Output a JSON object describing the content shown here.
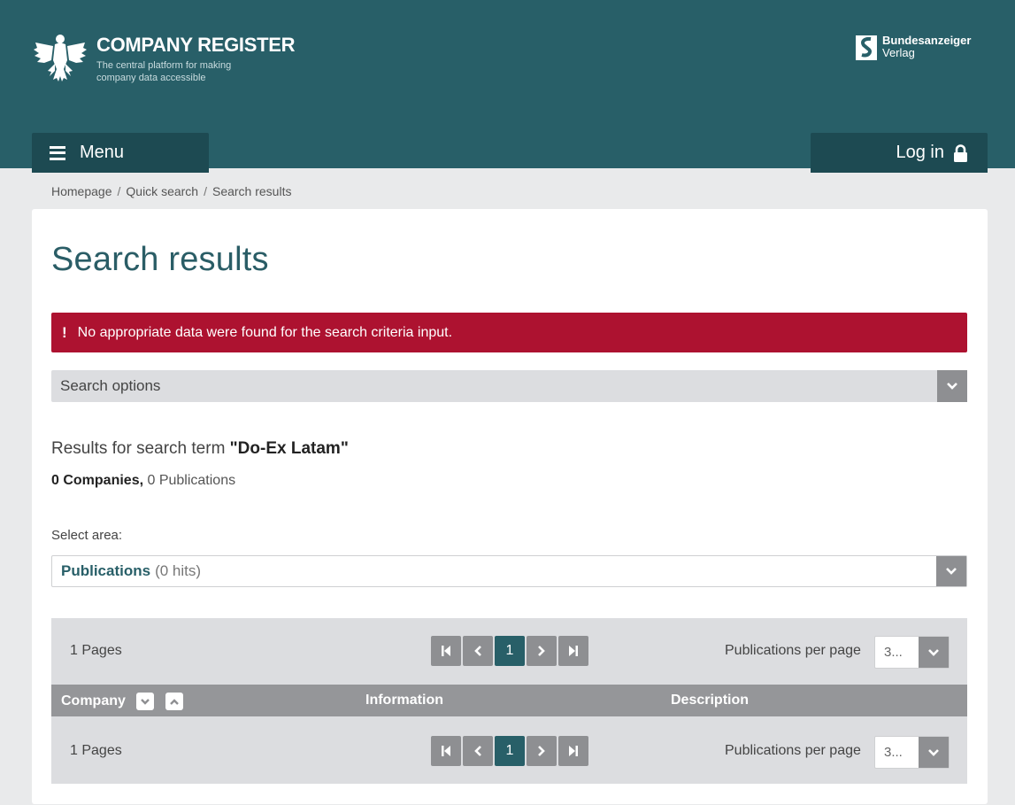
{
  "header": {
    "brand_title": "COMPANY REGISTER",
    "brand_subtitle": "The central platform for making company data accessible",
    "partner_line1": "Bundesanzeiger",
    "partner_line2": "Verlag",
    "menu_label": "Menu",
    "login_label": "Log in",
    "color_bg": "#285f68",
    "color_button": "#1d4a52"
  },
  "breadcrumb": {
    "items": [
      "Homepage",
      "Quick search",
      "Search results"
    ],
    "separator": "/"
  },
  "main": {
    "title": "Search results",
    "alert": {
      "icon": "exclamation-icon",
      "text": "No appropriate data were found for the search criteria input.",
      "color": "#ad1230"
    },
    "search_options_label": "Search options",
    "results_prefix": "Results for search term ",
    "search_term": "\"Do-Ex Latam\"",
    "counts": {
      "companies": "0 Companies,",
      "publications": "0 Publications"
    },
    "select_area_label": "Select area:",
    "area_select": {
      "selected": "Publications",
      "hits": "(0 hits)"
    },
    "pagination": {
      "pages_text": "1 Pages",
      "current_page": "1",
      "per_page_label": "Publications per page",
      "per_page_value": "3..."
    },
    "table": {
      "columns": [
        "Company",
        "Information",
        "Description"
      ]
    }
  }
}
